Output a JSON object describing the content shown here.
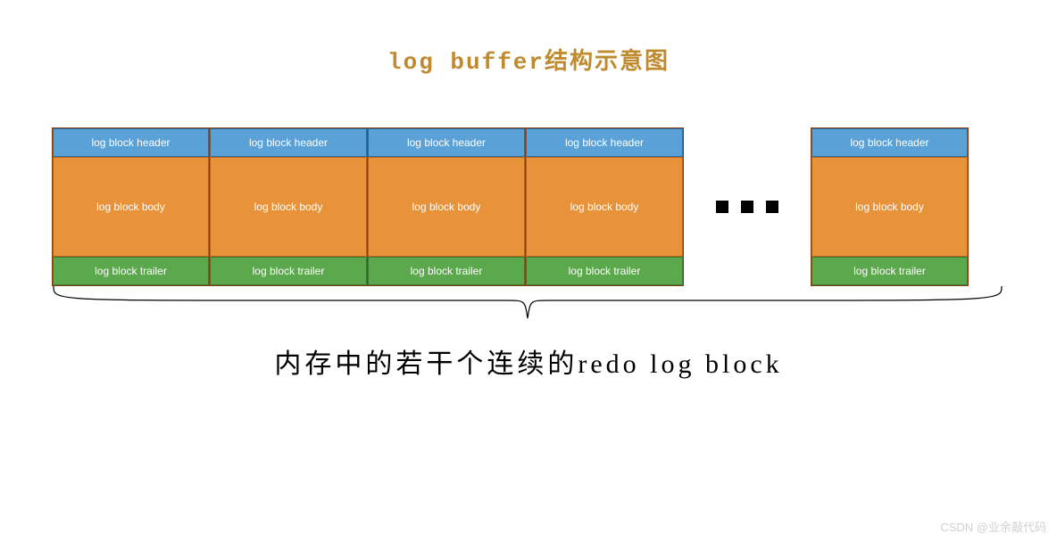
{
  "title": "log buffer结构示意图",
  "block_labels": {
    "header": "log block header",
    "body": "log block body",
    "trailer": "log block trailer"
  },
  "caption": "内存中的若干个连续的redo log block",
  "watermark": "CSDN @业余敲代码",
  "colors": {
    "title": "#c08a2e",
    "header_bg": "#5aa1d8",
    "body_bg": "#e8923a",
    "trailer_bg": "#5ba84d"
  },
  "block_count_left": 4,
  "block_count_right": 1
}
